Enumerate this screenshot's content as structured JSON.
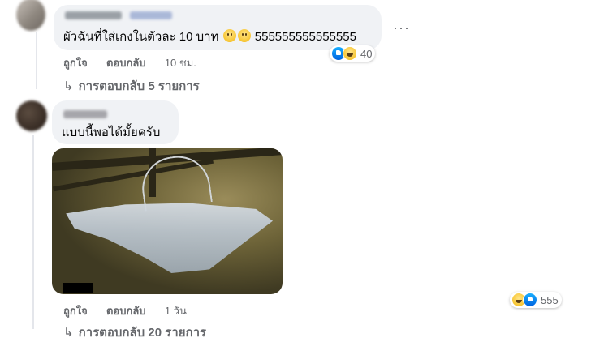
{
  "comment1": {
    "text": "ผัวฉันที่ใส่เกงในตัวละ 10 บาท",
    "text_suffix": "555555555555555",
    "emojis": [
      "slightly-smiling-face",
      "slightly-smiling-face"
    ],
    "actions": {
      "like": "ถูกใจ",
      "reply": "ตอบกลับ"
    },
    "time": "10 ชม.",
    "reactions": {
      "icons": [
        "like",
        "haha"
      ],
      "count": "40"
    },
    "more_label": "···"
  },
  "replies1": {
    "arrow": "↳",
    "label": "การตอบกลับ 5 รายการ"
  },
  "comment2": {
    "text": "แบบนี้พอได้มั้ยครับ",
    "actions": {
      "like": "ถูกใจ",
      "reply": "ตอบกลับ"
    },
    "time": "1 วัน",
    "reactions": {
      "icons": [
        "haha",
        "like"
      ],
      "count": "555"
    }
  },
  "replies2": {
    "arrow": "↳",
    "label": "การตอบกลับ 20 รายการ"
  },
  "colors": {
    "bubble": "#f0f2f5",
    "meta_text": "#65676b",
    "like_blue": "#1877f2",
    "haha_yellow": "#f7c531"
  }
}
